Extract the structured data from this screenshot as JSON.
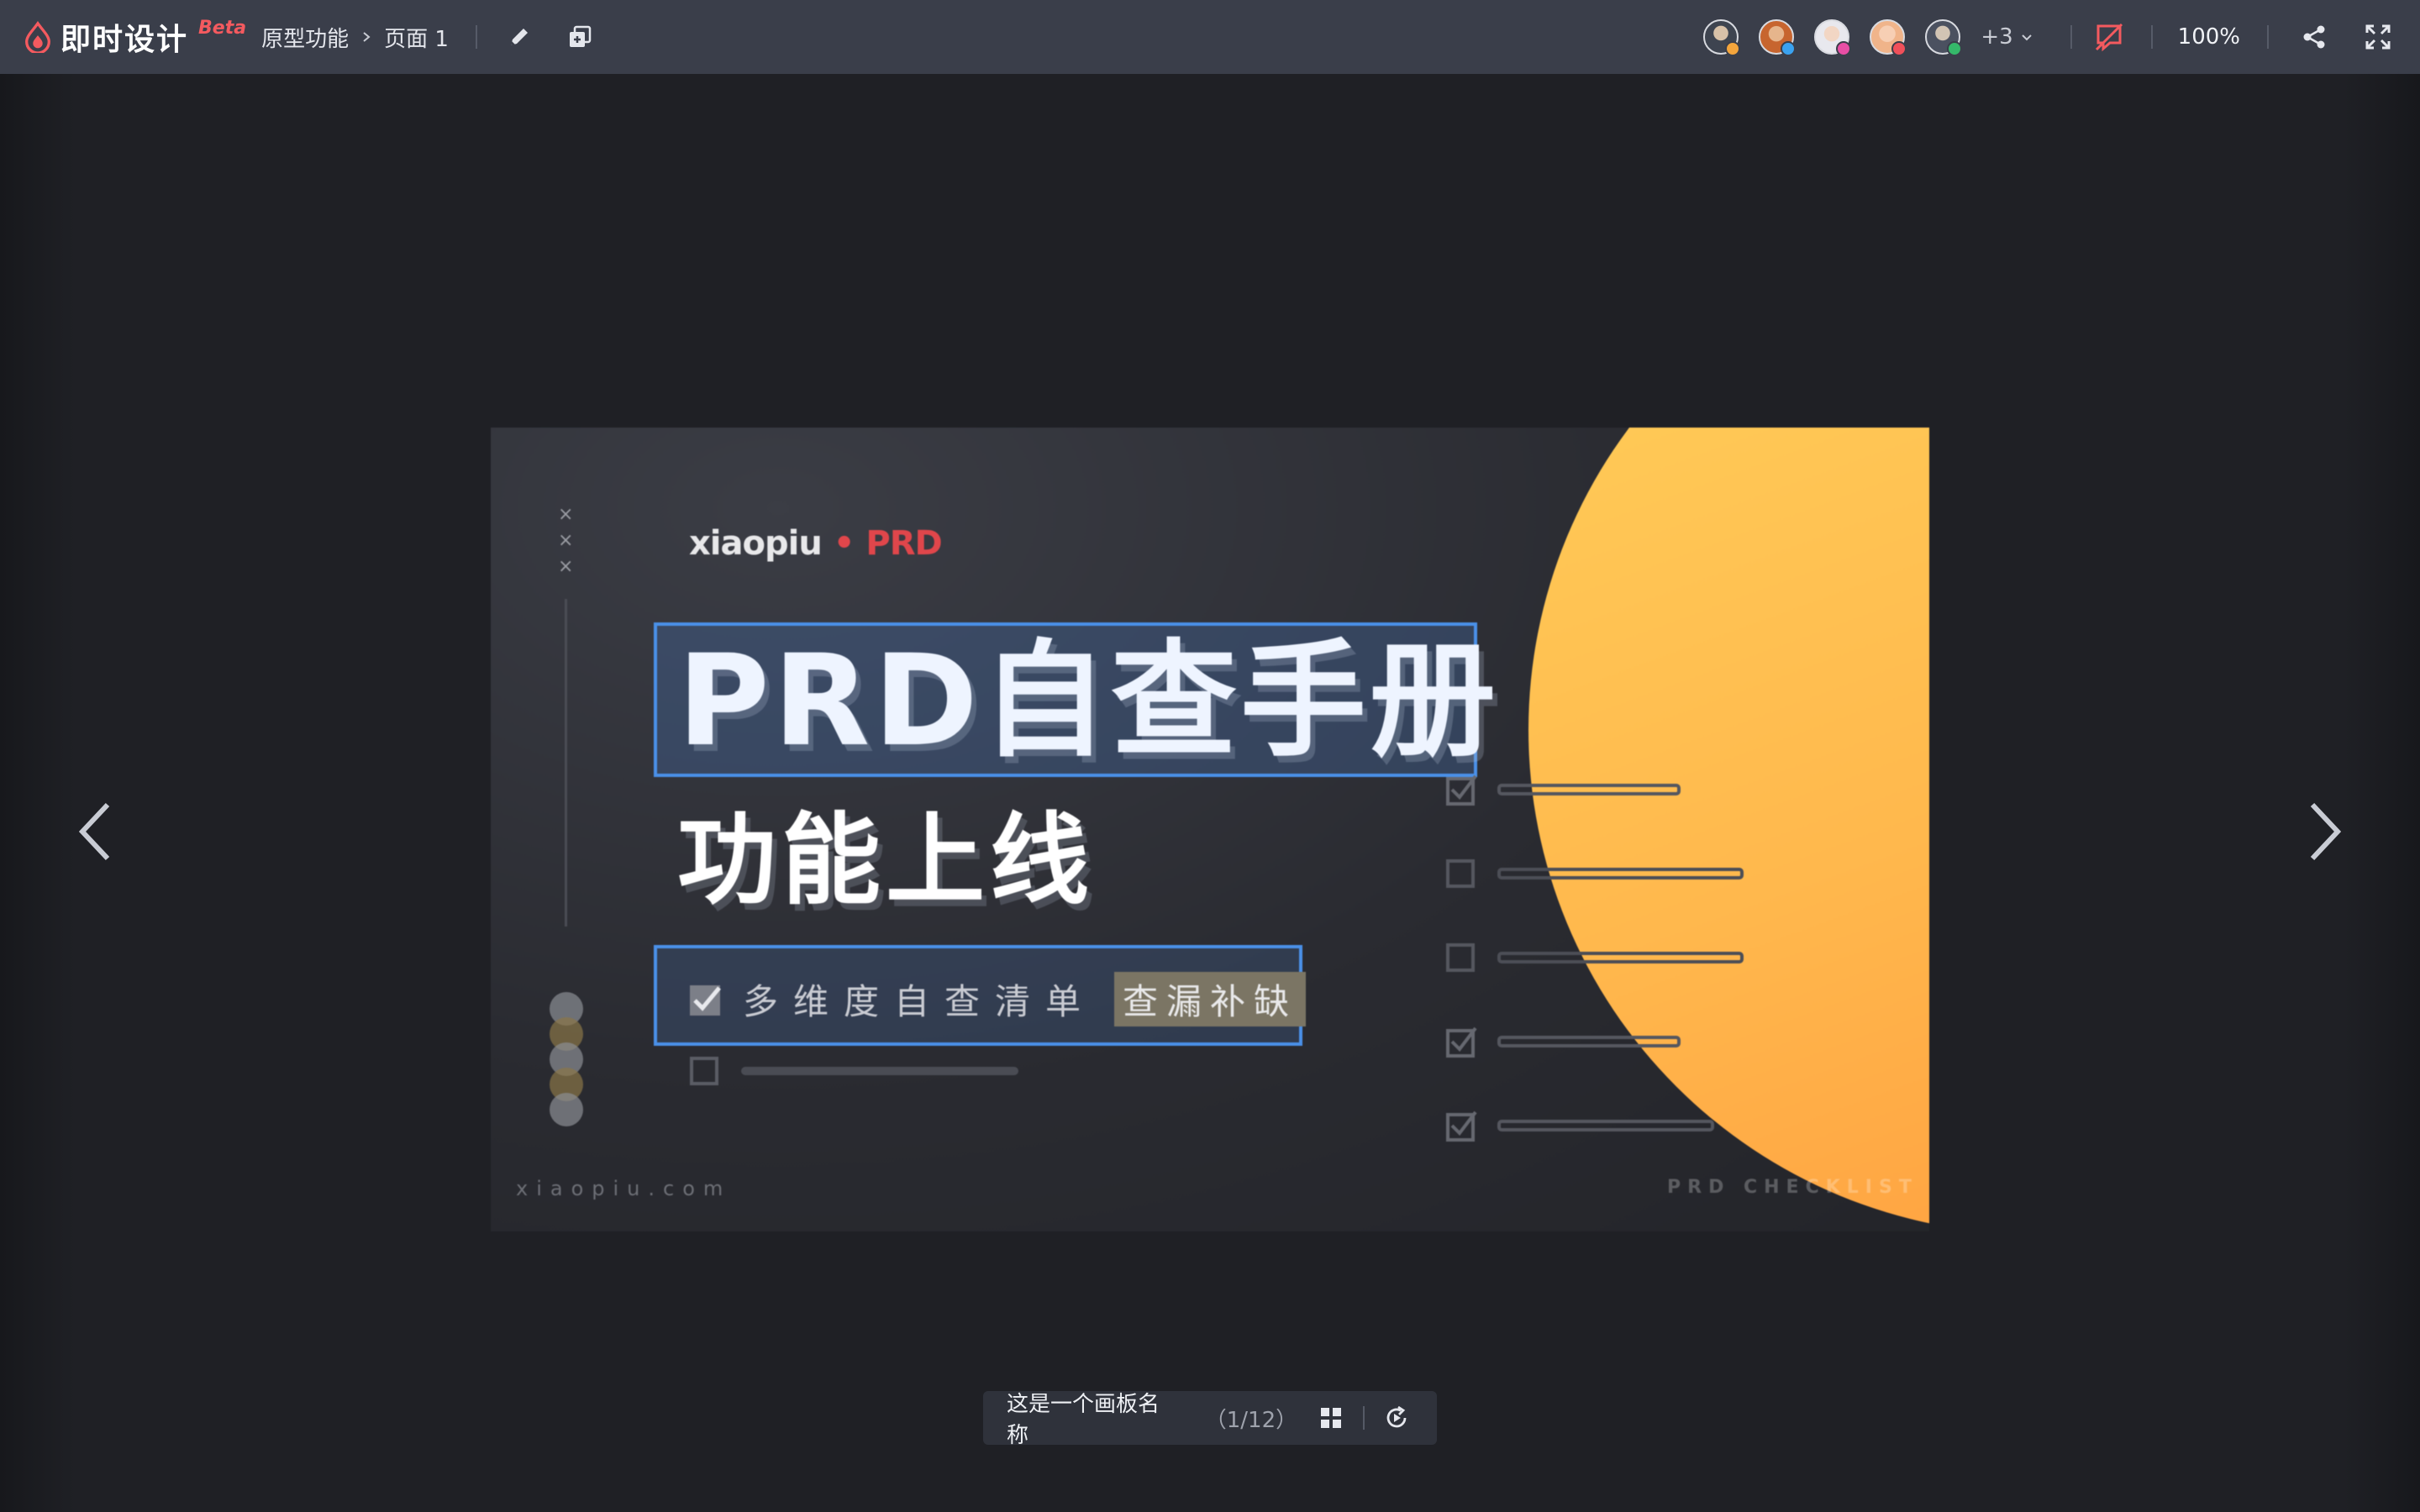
{
  "header": {
    "logo_text": "即时设计",
    "beta_label": "Beta",
    "breadcrumb": [
      "原型功能",
      "页面 1"
    ],
    "collaborators_more": "+3",
    "zoom_level": "100%"
  },
  "artboard": {
    "brand_name": "xiaopiu",
    "brand_dot": "•",
    "brand_suffix": "PRD",
    "title": "PRD自查手册",
    "subtitle": "功能上线",
    "checklist_text": "多维度自查清单",
    "tag_text": "查漏补缺",
    "site_url": "xiaopiu.com",
    "footer_label": "PRD CHECKLIST"
  },
  "footer": {
    "board_name": "这是一个画板名称",
    "board_count": "（1/12）"
  },
  "colors": {
    "topbar_bg": "#3a3e4a",
    "canvas_bg": "#1f2025",
    "accent_red": "#f45a5f",
    "selection_blue": "#4a90e8",
    "sun_orange": "#ffb84d"
  }
}
